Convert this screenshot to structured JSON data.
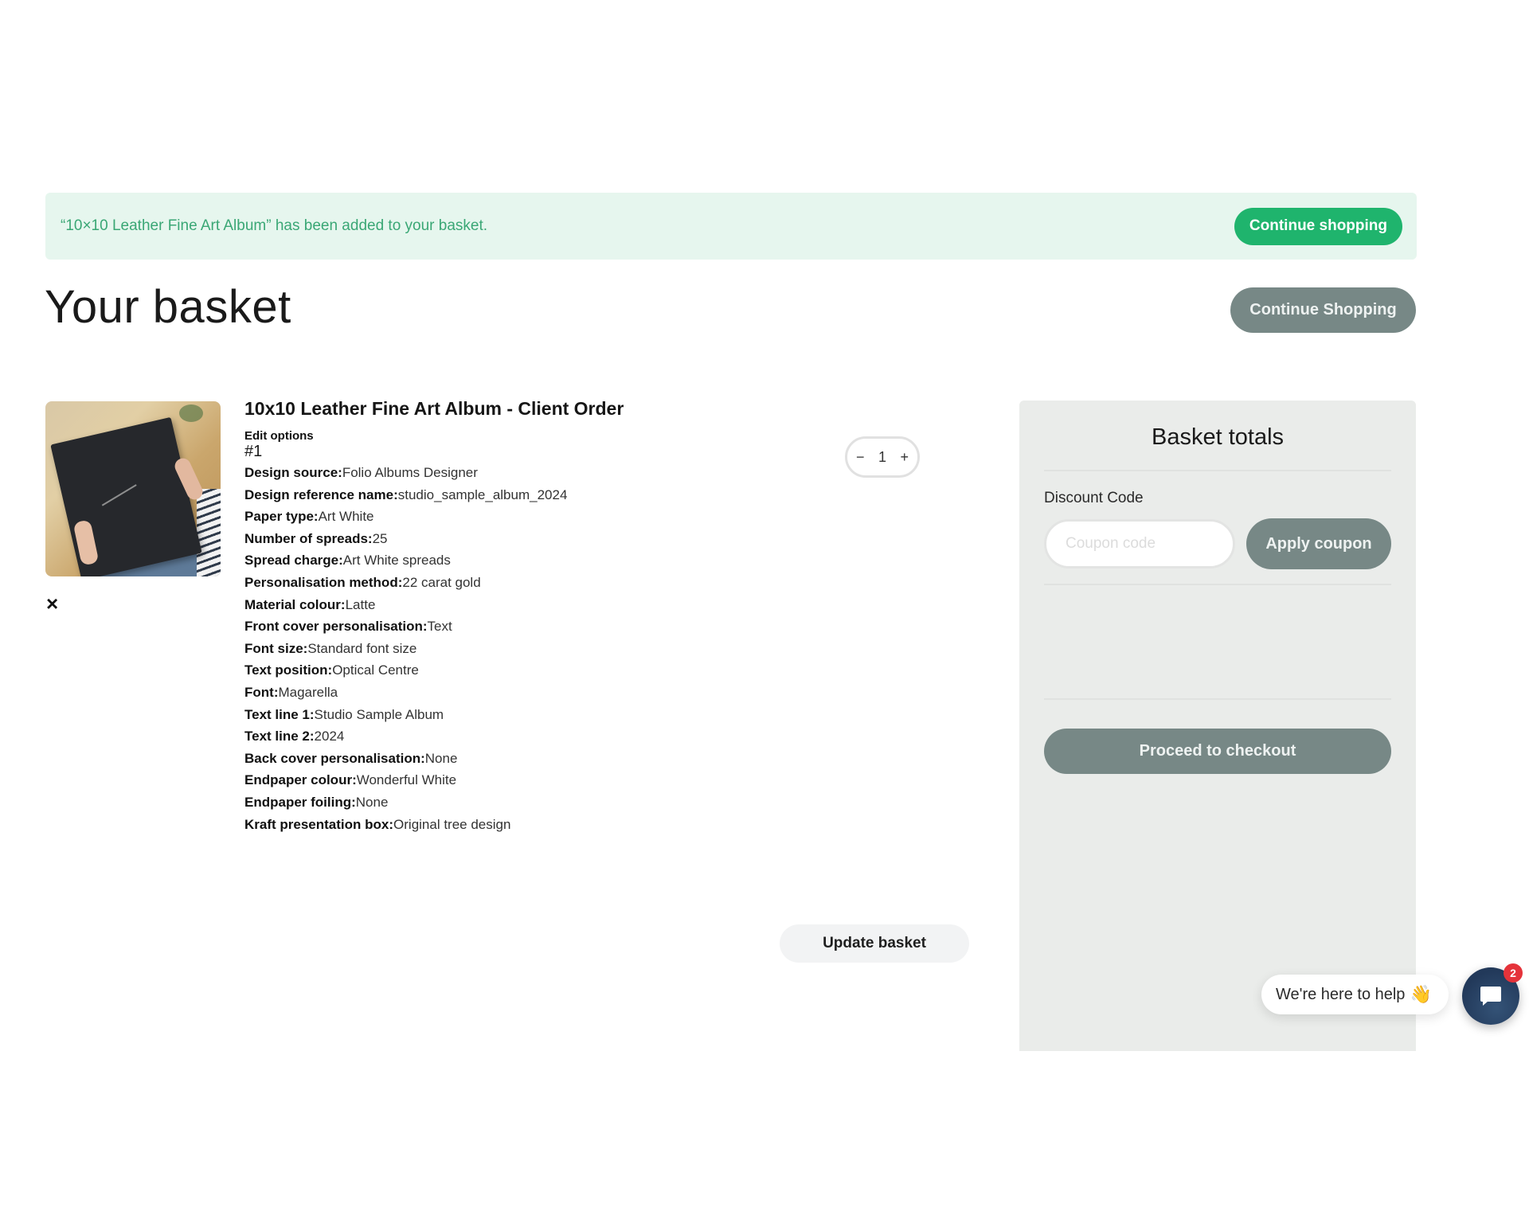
{
  "notice": {
    "message": "“10×10 Leather Fine Art Album” has been added to your basket.",
    "button_label": "Continue shopping"
  },
  "header": {
    "title": "Your basket",
    "continue_label": "Continue Shopping"
  },
  "item": {
    "title": "10x10 Leather Fine Art Album - Client Order",
    "edit_label": "Edit options",
    "number": "#1",
    "remove_icon": "×",
    "quantity": "1",
    "qty_minus": "−",
    "qty_plus": "+",
    "options": [
      {
        "label": "Design source:",
        "value": "Folio Albums Designer"
      },
      {
        "label": "Design reference name:",
        "value": "studio_sample_album_2024"
      },
      {
        "label": "Paper type:",
        "value": "Art White"
      },
      {
        "label": "Number of spreads:",
        "value": "25"
      },
      {
        "label": "Spread charge:",
        "value": "Art White spreads"
      },
      {
        "label": "Personalisation method:",
        "value": "22 carat gold"
      },
      {
        "label": "Material colour:",
        "value": "Latte"
      },
      {
        "label": "Front cover personalisation:",
        "value": "Text"
      },
      {
        "label": "Font size:",
        "value": "Standard font size"
      },
      {
        "label": "Text position:",
        "value": "Optical Centre"
      },
      {
        "label": "Font:",
        "value": "Magarella"
      },
      {
        "label": "Text line 1:",
        "value": "Studio Sample Album"
      },
      {
        "label": "Text line 2:",
        "value": "2024"
      },
      {
        "label": "Back cover personalisation:",
        "value": "None"
      },
      {
        "label": "Endpaper colour:",
        "value": "Wonderful White"
      },
      {
        "label": "Endpaper foiling:",
        "value": "None"
      },
      {
        "label": "Kraft presentation box:",
        "value": "Original tree design"
      }
    ]
  },
  "update_label": "Update basket",
  "totals": {
    "title": "Basket totals",
    "discount_label": "Discount Code",
    "coupon_placeholder": "Coupon code",
    "coupon_value": "",
    "apply_label": "Apply coupon",
    "checkout_label": "Proceed to checkout"
  },
  "chat": {
    "bubble_text": "We're here to help",
    "wave_emoji": "👋",
    "badge_count": "2"
  },
  "colors": {
    "notice_bg": "#e6f6ee",
    "notice_text": "#3aa775",
    "accent_green": "#1fb46d",
    "muted_button": "#778886",
    "panel_bg": "#eaecea",
    "chat_navy": "#22395a",
    "badge_red": "#e5333a"
  }
}
